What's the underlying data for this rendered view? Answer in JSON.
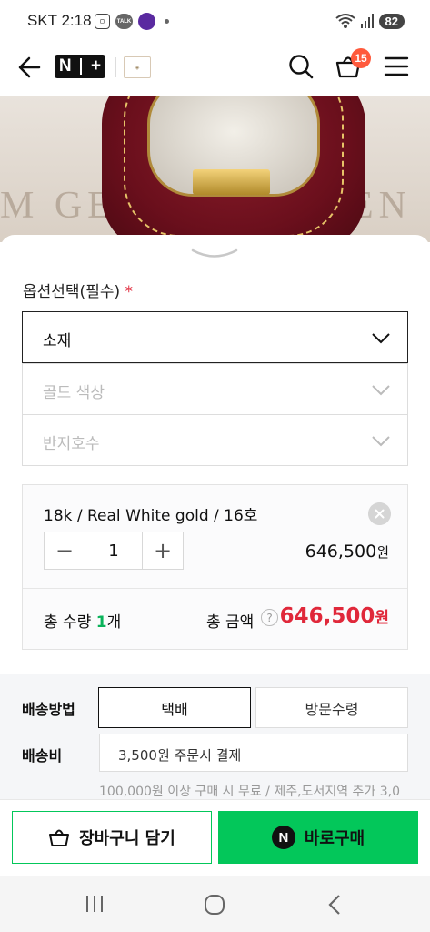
{
  "status_bar": {
    "carrier_time": "SKT 2:18",
    "talk_label": "TALK",
    "battery": "82"
  },
  "header": {
    "brand_badge_left": "N",
    "brand_badge_right": "+",
    "cart_count": "15"
  },
  "product_image": {
    "watermark_left": "M GE",
    "watermark_right": "EN"
  },
  "options": {
    "title": "옵션선택(필수)",
    "required_mark": "*",
    "selects": [
      {
        "label": "소재",
        "state": "active"
      },
      {
        "label": "골드 색상",
        "state": "disabled"
      },
      {
        "label": "반지호수",
        "state": "disabled"
      }
    ]
  },
  "selected_item": {
    "name": "18k / Real White gold / 16호",
    "quantity": "1",
    "minus": "−",
    "plus": "+",
    "price": "646,500",
    "price_unit": "원"
  },
  "totals": {
    "qty_label": "총 수량 ",
    "qty_value": "1",
    "qty_unit": "개",
    "amount_label": "총 금액",
    "help": "?",
    "amount": "646,500",
    "amount_unit": "원"
  },
  "shipping": {
    "method_label": "배송방법",
    "methods": [
      "택배",
      "방문수령"
    ],
    "selected_method": "택배",
    "fee_label": "배송비",
    "fee_value": "3,500원 주문시 결제",
    "fee_note": "100,000원 이상 구매 시 무료 / 제주,도서지역 추가 3,0"
  },
  "actions": {
    "cart_button": "장바구니 담기",
    "buy_logo": "N",
    "buy_button": "바로구매"
  },
  "colors": {
    "naver_green": "#03c75a",
    "price_red": "#e0283a",
    "badge_orange": "#ff5a3c"
  }
}
